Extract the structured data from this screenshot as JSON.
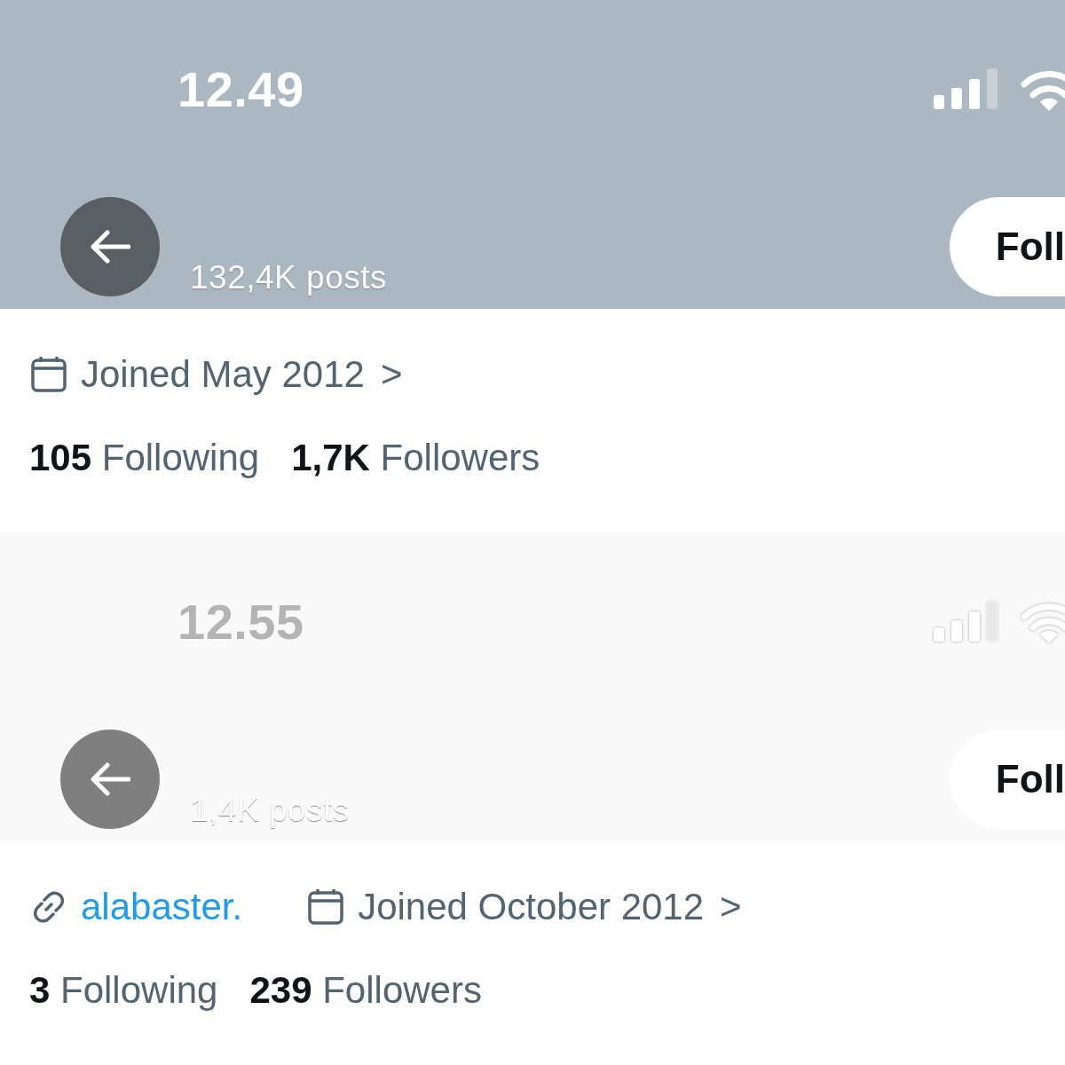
{
  "profiles": [
    {
      "header": {
        "color": "#abb7c1",
        "time": "12.49",
        "posts": "132,4K posts",
        "follow_button": "Foll"
      },
      "info": [
        {
          "kind": "joined",
          "text": "Joined May 2012",
          "chevron": ">"
        }
      ],
      "stats": [
        {
          "count": "105",
          "label": "Following"
        },
        {
          "count": "1,7K",
          "label": "Followers"
        }
      ]
    },
    {
      "header": {
        "color": "#f9f9f9",
        "time": "12.55",
        "posts": "1,4K posts",
        "follow_button": "Foll"
      },
      "info": [
        {
          "kind": "link",
          "text": "alabaster."
        },
        {
          "kind": "joined",
          "text": "Joined October 2012",
          "chevron": ">"
        }
      ],
      "stats": [
        {
          "count": "3",
          "label": "Following"
        },
        {
          "count": "239",
          "label": "Followers"
        }
      ]
    }
  ]
}
